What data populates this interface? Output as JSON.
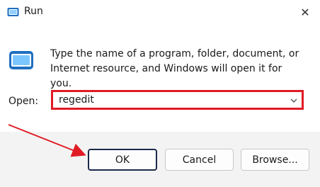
{
  "window": {
    "title": "Run",
    "title_icon": "run-app-icon",
    "close_icon": "close-icon"
  },
  "body": {
    "icon": "run-app-icon",
    "description": "Type the name of a program, folder, document, or Internet resource, and Windows will open it for you."
  },
  "open": {
    "label": "Open:",
    "value": "regedit",
    "dropdown_icon": "chevron-down-icon"
  },
  "buttons": {
    "ok": "OK",
    "cancel": "Cancel",
    "browse": "Browse..."
  },
  "annotation": {
    "highlight_color": "#e01b24",
    "arrow_color": "#e01b24"
  }
}
